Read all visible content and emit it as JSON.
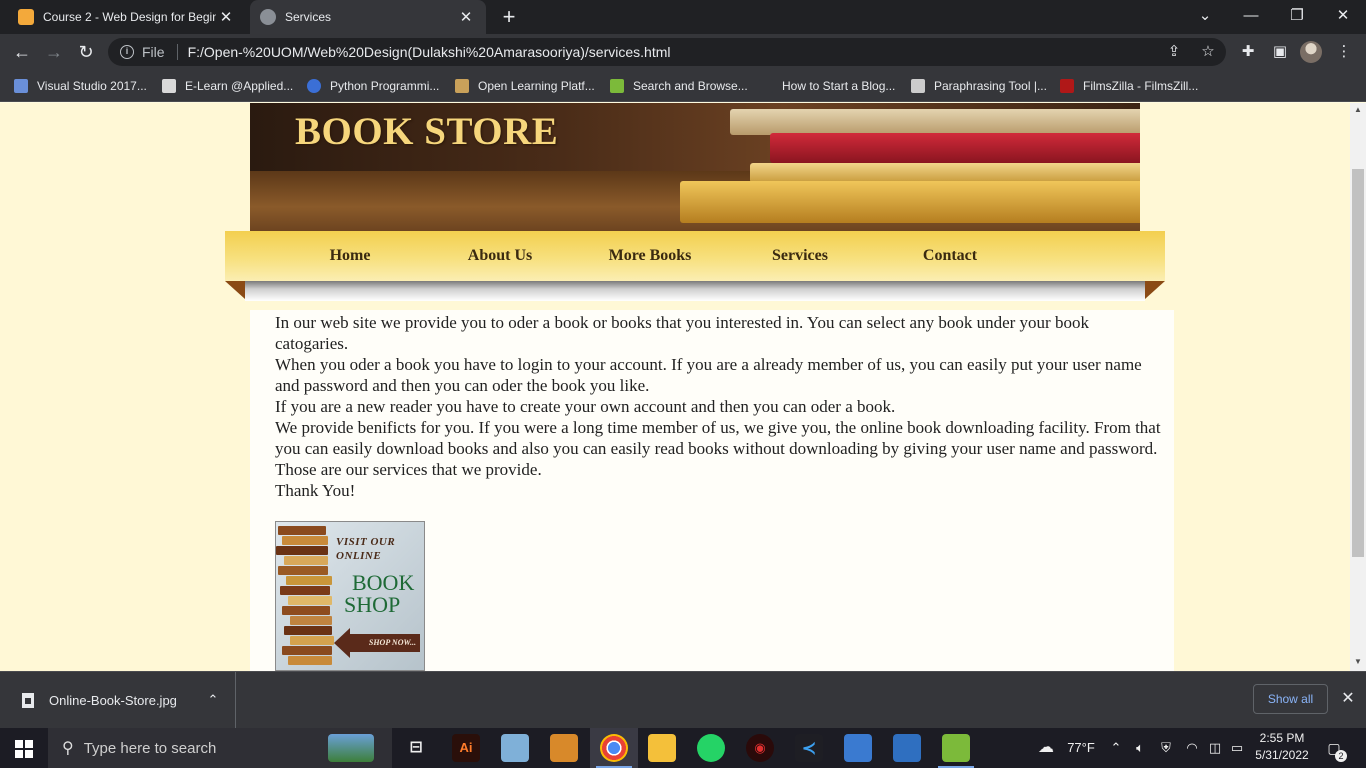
{
  "browser": {
    "tabs": [
      {
        "title": "Course 2 - Web Design for Begin",
        "active": false
      },
      {
        "title": "Services",
        "active": true
      }
    ],
    "new_tab": "+",
    "window_controls": {
      "minimize": "—",
      "restore": "❐",
      "close": "✕",
      "tab_search": "⌄"
    },
    "address_bar": {
      "scheme_label": "File",
      "url": "F:/Open-%20UOM/Web%20Design(Dulakshi%20Amarasooriya)/services.html"
    },
    "bookmarks": [
      {
        "label": "Visual Studio 2017...",
        "color": "#6a8fd8"
      },
      {
        "label": "E-Learn @Applied...",
        "color": "#d9d9d9"
      },
      {
        "label": "Python Programmi...",
        "color": "#3b6fd6"
      },
      {
        "label": "Open Learning Platf...",
        "color": "#c9a15a"
      },
      {
        "label": "Search and Browse...",
        "color": "#7cba3a"
      },
      {
        "label": "How to Start a Blog...",
        "color": "#35363a"
      },
      {
        "label": "Paraphrasing Tool |...",
        "color": "#cccccc"
      },
      {
        "label": "FilmsZilla - FilmsZill...",
        "color": "#b01818"
      }
    ]
  },
  "page": {
    "banner_title": "BOOK STORE",
    "nav": [
      "Home",
      "About Us",
      "More Books",
      "Services",
      "Contact"
    ],
    "paragraphs": [
      "In our web site we provide you to oder a book or books that you interested in. You can select any book under your book catogaries.",
      "When you oder a book you have to login to your account. If you are a already member of us, you can easily put your user name and password and then you can oder the book you like.",
      "If you are a new reader you have to create your own account and then you can oder a book.",
      "We provide benificts for you. If you were a long time member of us, we give you, the online book downloading facility. From that you can easily download books and also you can easily read books without downloading by giving your user name and password.",
      "Those are our services that we provide.",
      "Thank You!"
    ],
    "promo": {
      "line1": "VISIT OUR",
      "line2": "ONLINE",
      "line3": "BOOK",
      "line4": "SHOP",
      "cta": "SHOP NOW..."
    },
    "colors": {
      "banner_title": "#f6d67c",
      "nav_bar": "#f3cf4f",
      "page_bg": "#fff8d6"
    }
  },
  "downloads": {
    "file_name": "Online-Book-Store.jpg",
    "show_all": "Show all"
  },
  "taskbar": {
    "search_placeholder": "Type here to search",
    "weather": "77°F",
    "time": "2:55 PM",
    "date": "5/31/2022",
    "notification_count": "2"
  }
}
